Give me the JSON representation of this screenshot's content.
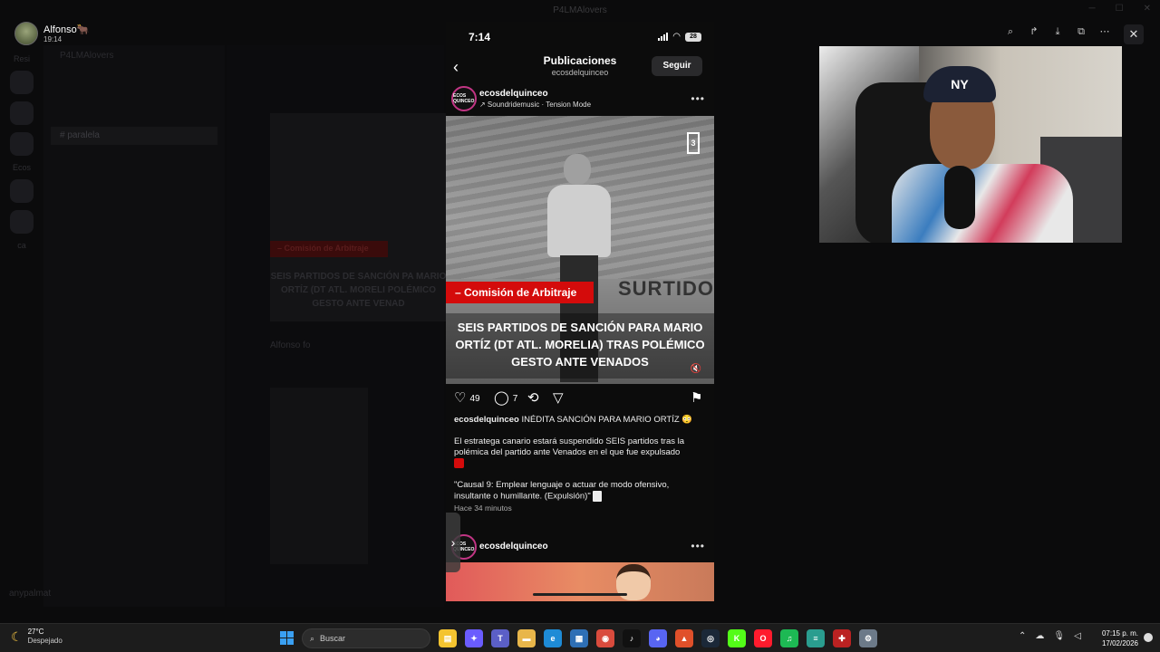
{
  "background_app": {
    "window_title": "P4LMAlovers",
    "server_name": "P4LMAlovers",
    "channel_active": "# paralela",
    "left_labels": [
      "Resi",
      "Ecos",
      "ca"
    ],
    "bg_red_tag": "– Comisión de Arbitraje",
    "bg_headline": "SEIS PARTIDOS DE SANCIÓN PA MARIO ORTÍZ (DT ATL. MORELI POLÉMICO GESTO ANTE VENAD",
    "bg_user": "Alfonso fo",
    "bottom_user": "anypalmat"
  },
  "stream_user": {
    "name": "Alfonso🐂",
    "time": "19:14"
  },
  "viewer_toolbar": {
    "icons": [
      "zoom-in-icon",
      "share-icon",
      "download-icon",
      "open-external-icon",
      "more-icon"
    ],
    "close": "✕"
  },
  "phone": {
    "status_time": "7:14",
    "battery": "28",
    "header_title": "Publicaciones",
    "header_subtitle": "ecosdelquinceo",
    "follow_label": "Seguir",
    "post": {
      "avatar_text": "ECOS QUINCEO",
      "username": "ecosdelquinceo",
      "music": "↗ Soundridemusic · Tension Mode",
      "image": {
        "brand_logo": "3",
        "sponsor": "SURTIDO",
        "red_tag": "– Comisión de Arbitraje",
        "headline": "SEIS PARTIDOS DE SANCIÓN PARA MARIO ORTÍZ (DT ATL. MORELIA) TRAS POLÉMICO GESTO ANTE VENADOS",
        "mute_icon": "🔇"
      },
      "likes": "49",
      "comments": "7",
      "caption_user": "ecosdelquinceo",
      "caption_title": "INÉDITA SANCIÓN PARA MARIO ORTÍZ 😳",
      "caption_body": "El estratega canario estará suspendido SEIS partidos tras la polémica del partido ante Venados en el que fue expulsado",
      "caption_quote": "\"Causal 9: Emplear lenguaje o actuar de modo ofensivo, insultante o humillante. (Expulsión)\"",
      "time_ago": "Hace 34 minutos"
    },
    "post2": {
      "username": "ecosdelquinceo",
      "avatar_text": "ECOS QUINCEO"
    }
  },
  "webcam": {
    "cap_logo": "NY"
  },
  "taskbar": {
    "temp": "27°C",
    "weather": "Despejado",
    "search_placeholder": "Buscar",
    "clock_time": "07:15 p. m.",
    "clock_date": "17/02/2026",
    "apps": [
      {
        "name": "file-explorer",
        "color": "#f4c430",
        "glyph": "▤"
      },
      {
        "name": "copilot",
        "color": "#6a5cff",
        "glyph": "✦"
      },
      {
        "name": "teams",
        "color": "#5b5fc7",
        "glyph": "T"
      },
      {
        "name": "folder",
        "color": "#e8b64a",
        "glyph": "▬"
      },
      {
        "name": "edge",
        "color": "#1e8bd6",
        "glyph": "e"
      },
      {
        "name": "calculator",
        "color": "#2e6fb5",
        "glyph": "▦"
      },
      {
        "name": "chrome",
        "color": "#d94b3d",
        "glyph": "◉"
      },
      {
        "name": "tiktok",
        "color": "#111",
        "glyph": "♪"
      },
      {
        "name": "discord",
        "color": "#5865f2",
        "glyph": "◕"
      },
      {
        "name": "brave",
        "color": "#e0502a",
        "glyph": "▲"
      },
      {
        "name": "steam",
        "color": "#1b2838",
        "glyph": "◎"
      },
      {
        "name": "kick",
        "color": "#53fc18",
        "glyph": "K"
      },
      {
        "name": "opera",
        "color": "#ff1b2d",
        "glyph": "O"
      },
      {
        "name": "spotify",
        "color": "#1db954",
        "glyph": "♫"
      },
      {
        "name": "notepad",
        "color": "#2a9d8f",
        "glyph": "≡"
      },
      {
        "name": "game",
        "color": "#b22",
        "glyph": "✚"
      },
      {
        "name": "settings",
        "color": "#6c7a89",
        "glyph": "⚙"
      }
    ]
  }
}
